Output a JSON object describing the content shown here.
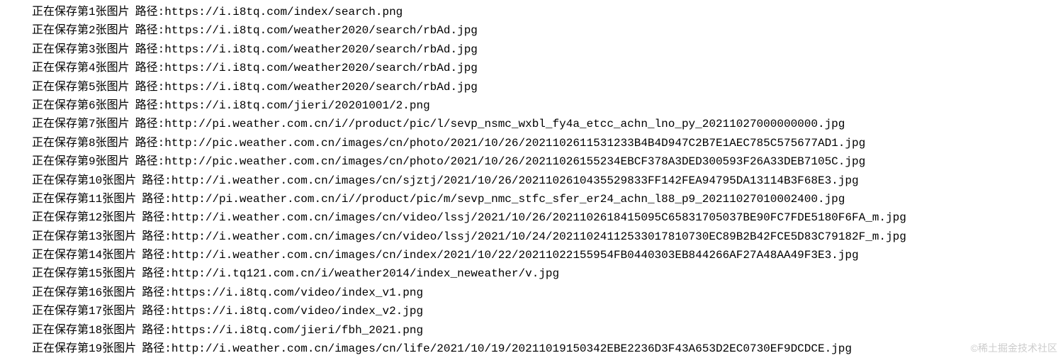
{
  "logs": [
    {
      "index": 1,
      "url": "https://i.i8tq.com/index/search.png"
    },
    {
      "index": 2,
      "url": "https://i.i8tq.com/weather2020/search/rbAd.jpg"
    },
    {
      "index": 3,
      "url": "https://i.i8tq.com/weather2020/search/rbAd.jpg"
    },
    {
      "index": 4,
      "url": "https://i.i8tq.com/weather2020/search/rbAd.jpg"
    },
    {
      "index": 5,
      "url": "https://i.i8tq.com/weather2020/search/rbAd.jpg"
    },
    {
      "index": 6,
      "url": "https://i.i8tq.com/jieri/20201001/2.png"
    },
    {
      "index": 7,
      "url": "http://pi.weather.com.cn/i//product/pic/l/sevp_nsmc_wxbl_fy4a_etcc_achn_lno_py_20211027000000000.jpg"
    },
    {
      "index": 8,
      "url": "http://pic.weather.com.cn/images/cn/photo/2021/10/26/2021102611531233B4B4D947C2B7E1AEC785C575677AD1.jpg"
    },
    {
      "index": 9,
      "url": "http://pic.weather.com.cn/images/cn/photo/2021/10/26/20211026155234EBCF378A3DED300593F26A33DEB7105C.jpg"
    },
    {
      "index": 10,
      "url": "http://i.weather.com.cn/images/cn/sjztj/2021/10/26/2021102610435529833FF142FEA94795DA13114B3F68E3.jpg"
    },
    {
      "index": 11,
      "url": "http://pi.weather.com.cn/i//product/pic/m/sevp_nmc_stfc_sfer_er24_achn_l88_p9_20211027010002400.jpg"
    },
    {
      "index": 12,
      "url": "http://i.weather.com.cn/images/cn/video/lssj/2021/10/26/2021102618415095C65831705037BE90FC7FDE5180F6FA_m.jpg"
    },
    {
      "index": 13,
      "url": "http://i.weather.com.cn/images/cn/video/lssj/2021/10/24/20211024112533017810730EC89B2B42FCE5D83C79182F_m.jpg"
    },
    {
      "index": 14,
      "url": "http://i.weather.com.cn/images/cn/index/2021/10/22/20211022155954FB0440303EB844266AF27A48AA49F3E3.jpg"
    },
    {
      "index": 15,
      "url": "http://i.tq121.com.cn/i/weather2014/index_neweather/v.jpg"
    },
    {
      "index": 16,
      "url": "https://i.i8tq.com/video/index_v1.png"
    },
    {
      "index": 17,
      "url": "https://i.i8tq.com/video/index_v2.jpg"
    },
    {
      "index": 18,
      "url": "https://i.i8tq.com/jieri/fbh_2021.png"
    },
    {
      "index": 19,
      "url": "http://i.weather.com.cn/images/cn/life/2021/10/19/20211019150342EBE2236D3F43A653D2EC0730EF9DCDCE.jpg"
    }
  ],
  "labels": {
    "prefix_before": "正在保存第",
    "prefix_after": "张图片",
    "path_label": "路径:"
  },
  "watermark": "©稀土掘金技术社区"
}
